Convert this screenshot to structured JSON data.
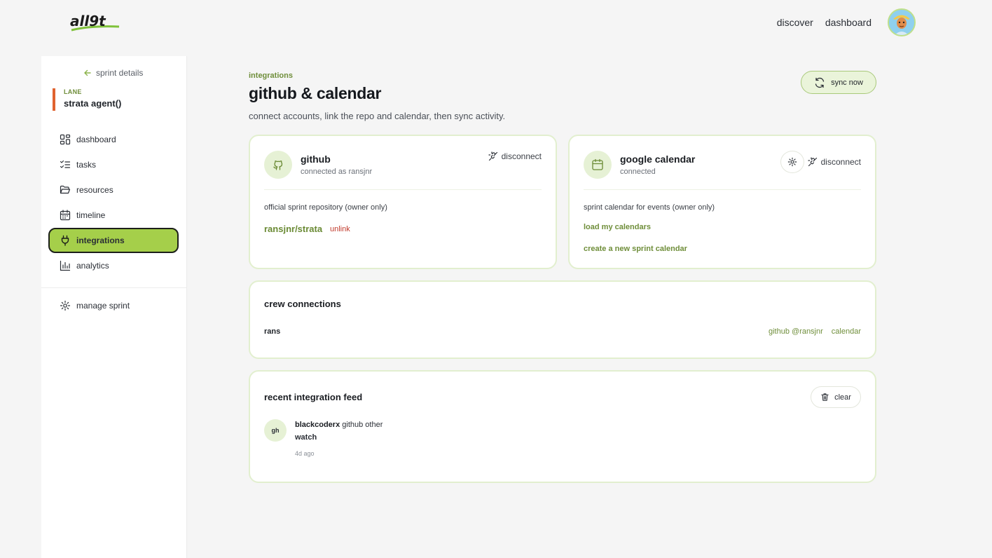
{
  "brand": {
    "logo_text": "all9t"
  },
  "topnav": {
    "discover": "discover",
    "dashboard": "dashboard"
  },
  "sidebar": {
    "back_label": "sprint details",
    "lane_tag": "LANE",
    "lane_name": "strata agent()",
    "items": [
      {
        "label": "dashboard",
        "icon": "layout-grid-icon"
      },
      {
        "label": "tasks",
        "icon": "list-checks-icon"
      },
      {
        "label": "resources",
        "icon": "folder-open-icon"
      },
      {
        "label": "timeline",
        "icon": "calendar-icon"
      },
      {
        "label": "integrations",
        "icon": "plug-icon",
        "active": true
      },
      {
        "label": "analytics",
        "icon": "bar-chart-icon"
      }
    ],
    "manage_label": "manage sprint"
  },
  "page": {
    "crumb": "integrations",
    "title": "github & calendar",
    "subtitle": "connect accounts, link the repo and calendar, then sync activity.",
    "sync_label": "sync now"
  },
  "github": {
    "name": "github",
    "status": "connected as ransjnr",
    "disconnect_label": "disconnect",
    "repo_label": "official sprint repository (owner only)",
    "repo": "ransjnr/strata",
    "unlink_label": "unlink"
  },
  "calendar": {
    "name": "google calendar",
    "status": "connected",
    "disconnect_label": "disconnect",
    "cal_label": "sprint calendar for events (owner only)",
    "load_label": "load my calendars",
    "create_label": "create a new sprint calendar"
  },
  "crew": {
    "title": "crew connections",
    "members": [
      {
        "name": "rans",
        "github": "github @ransjnr",
        "calendar": "calendar"
      }
    ]
  },
  "feed": {
    "title": "recent integration feed",
    "clear_label": "clear",
    "items": [
      {
        "avatar": "gh",
        "user": "blackcoderx",
        "meta": "github other",
        "action": "watch",
        "time": "4d ago"
      }
    ]
  },
  "colors": {
    "accent": "#a5cf4a",
    "accent_text": "#6f8e3a",
    "lane_bar": "#e0622f",
    "danger": "#c0392b"
  }
}
